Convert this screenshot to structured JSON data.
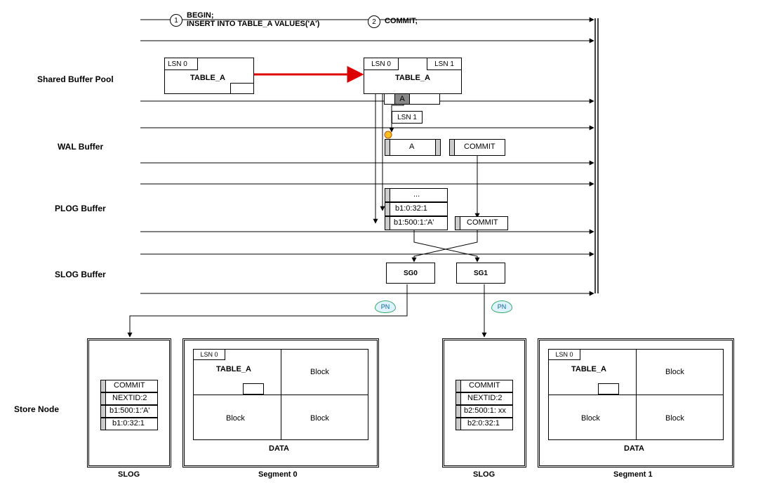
{
  "steps": {
    "s1_num": "1",
    "s1_text": "BEGIN;\nINSERT INTO TABLE_A VALUES('A')",
    "s2_num": "2",
    "s2_text": "COMMIT;"
  },
  "labels": {
    "shared_buffer_pool": "Shared Buffer Pool",
    "wal_buffer": "WAL Buffer",
    "plog_buffer": "PLOG Buffer",
    "slog_buffer": "SLOG Buffer",
    "store_node": "Store Node"
  },
  "shared": {
    "left_lsn": "LSN 0",
    "left_table": "TABLE_A",
    "right_lsn0": "LSN 0",
    "right_lsn1": "LSN 1",
    "right_table": "TABLE_A",
    "row_a": "A"
  },
  "wal": {
    "lsn_badge": "LSN 1",
    "rec_a": "A",
    "rec_commit": "COMMIT"
  },
  "plog": {
    "r0": "...",
    "r1": "b1:0:32:1",
    "r2": "b1:500:1:'A'",
    "commit": "COMMIT"
  },
  "slog": {
    "sg0": "SG0",
    "sg1": "SG1"
  },
  "pn": "PN",
  "store": {
    "slog_title": "SLOG",
    "seg0_title": "Segment 0",
    "seg1_title": "Segment 1",
    "data_title": "DATA",
    "lsn0": "LSN 0",
    "table_a": "TABLE_A",
    "block": "Block",
    "left_rows": [
      "COMMIT",
      "NEXTID:2",
      "b1:500:1:'A'",
      "b1:0:32:1"
    ],
    "right_rows": [
      "COMMIT",
      "NEXTID:2",
      "b2:500:1: xx",
      "b2:0:32:1"
    ]
  }
}
